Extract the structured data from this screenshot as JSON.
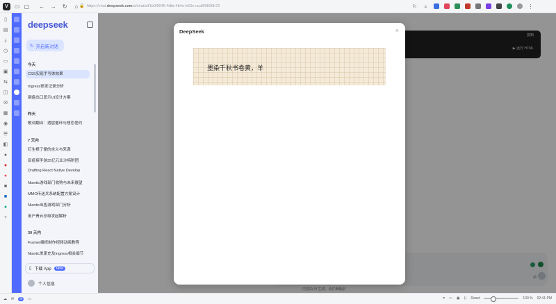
{
  "browser": {
    "url_prefix": "https://chat.",
    "url_domain": "deepseek.com",
    "url_rest": "/a/chat/s/f1b0f9045-4dfa-4b4e-b53e-cca6f0830b72"
  },
  "sidebar": {
    "brand": "deepseek",
    "new_chat": "开启新对话",
    "groups": [
      {
        "label": "今天",
        "items": [
          "CSS实现手写体效果",
          "Ingress研发记录分析",
          "钢盘出口显示UI设计方案"
        ]
      },
      {
        "label": "昨天",
        "items": [
          "歌词翻译：透层循环与想恋差约"
        ]
      },
      {
        "label": "7 天内",
        "items": [
          "钉生根了便的含义与来源",
          "后疫探手游35亿元业沙特附团",
          "Drafting React Native Develop",
          "Niantic游戏部门收购与未来展望",
          "MMO传送兵系统配置方案设计",
          "Niantic出售游戏部门分析",
          "用户青云总级发起解析"
        ]
      },
      {
        "label": "30 天内",
        "items": [
          "Framer编修制作视频动画教程",
          "Niantic发家史及Ingress相关细节"
        ]
      }
    ],
    "download_label": "下载 App",
    "download_badge": "NEW",
    "user_label": "个人信息"
  },
  "main": {
    "code_header": "复制",
    "code_run": "运行 HTML",
    "disclaimer": "内容由 AI 生成，请仔细甄别"
  },
  "modal": {
    "title": "DeepSeek",
    "close": "×",
    "poem_text": "墨染千秋书卷黄，羊"
  },
  "status": {
    "zoom_label": "100 %",
    "reset_label": "Reset",
    "time": "02:41 PM"
  }
}
